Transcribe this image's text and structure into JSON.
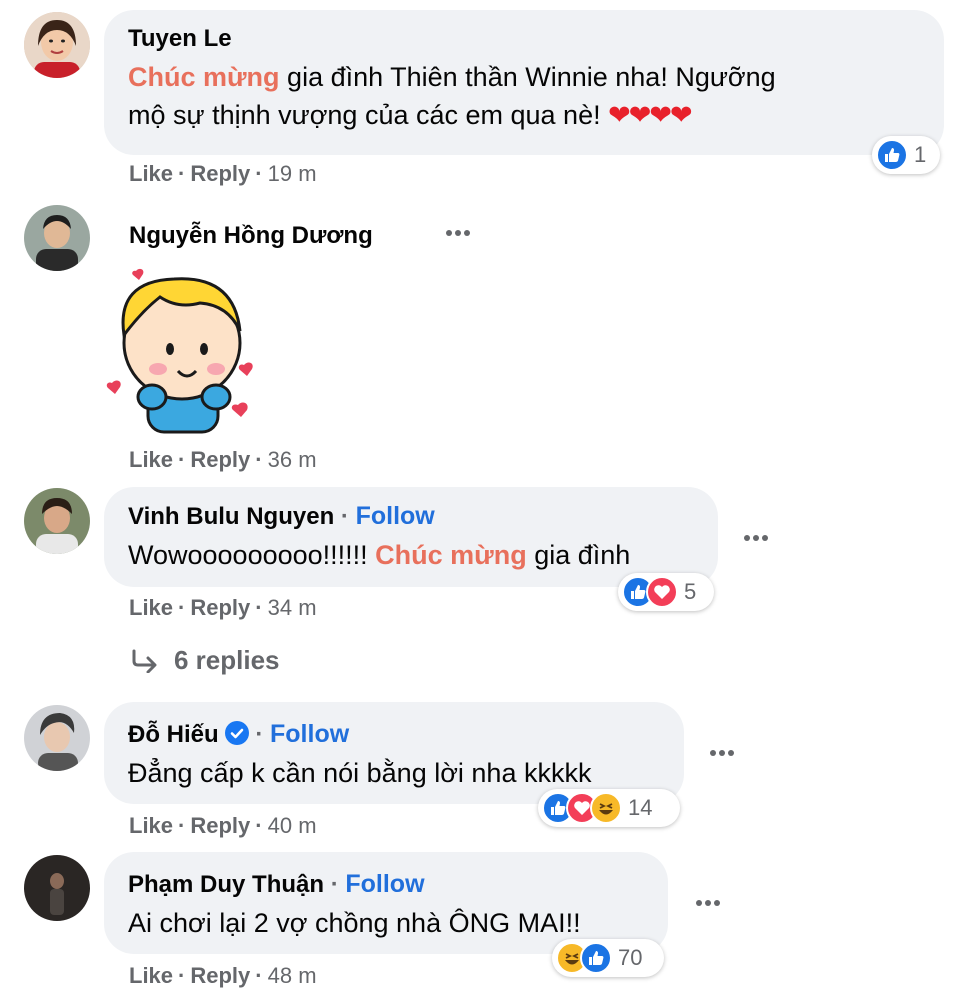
{
  "comments": [
    {
      "author": "Tuyen Le",
      "text_parts": [
        "Chúc mừng",
        " gia đình Thiên thần Winnie nha! Ngưỡng",
        "mộ sự thịnh vượng của các em qua nè! "
      ],
      "like": "Like",
      "reply": "Reply",
      "time": "19 m",
      "reaction_count": "1"
    },
    {
      "author": "Nguyễn Hồng Dương",
      "like": "Like",
      "reply": "Reply",
      "time": "36 m"
    },
    {
      "author": "Vinh Bulu Nguyen",
      "follow": "Follow",
      "text_parts": [
        "Wowooooooooo!!!!!! ",
        "Chúc mừng",
        " gia đình"
      ],
      "like": "Like",
      "reply": "Reply",
      "time": "34 m",
      "reaction_count": "5",
      "replies_label": "6 replies"
    },
    {
      "author": "Đỗ Hiếu",
      "follow": "Follow",
      "text": "Đẳng cấp k cần nói bằng lời nha kkkkk",
      "like": "Like",
      "reply": "Reply",
      "time": "40 m",
      "reaction_count": "14"
    },
    {
      "author": "Phạm Duy Thuận",
      "follow": "Follow",
      "text": "Ai chơi lại 2 vợ chồng nhà ÔNG MAI!!",
      "like": "Like",
      "reply": "Reply",
      "time": "48 m",
      "reaction_count": "70"
    }
  ],
  "colors": {
    "highlight": "#e8705c",
    "follow": "#216fdb",
    "bubble": "#f0f2f5",
    "meta": "#65676b"
  }
}
